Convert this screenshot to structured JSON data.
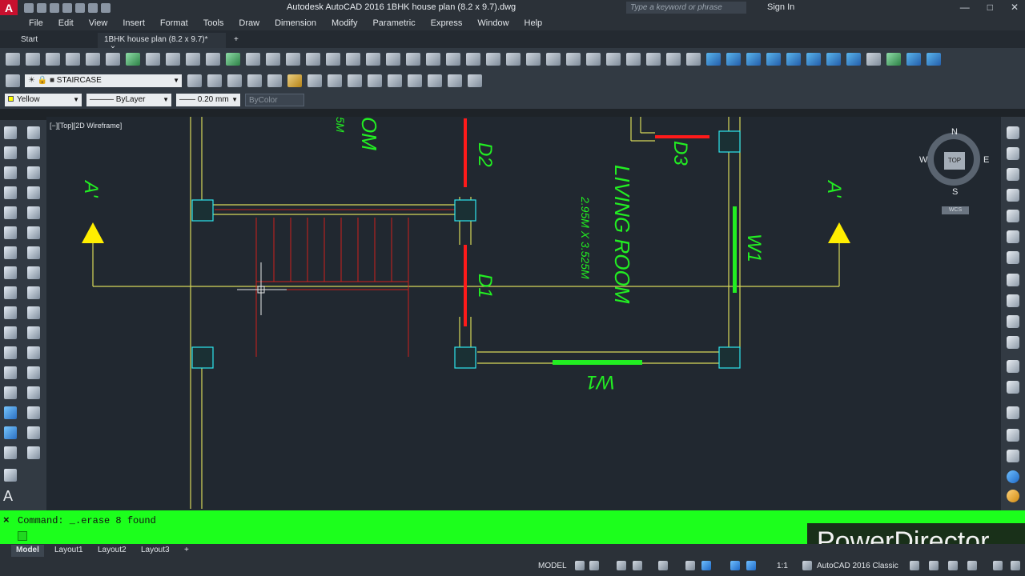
{
  "app": {
    "title": "Autodesk AutoCAD 2016    1BHK house plan (8.2 x 9.7).dwg",
    "search_placeholder": "Type a keyword or phrase",
    "sign_in": "Sign In",
    "logo": "A"
  },
  "menu": [
    "File",
    "Edit",
    "View",
    "Insert",
    "Format",
    "Tools",
    "Draw",
    "Dimension",
    "Modify",
    "Parametric",
    "Express",
    "Window",
    "Help"
  ],
  "doc_tabs": {
    "start": "Start",
    "active": "1BHK house plan (8.2 x 9.7)*",
    "close": "×",
    "add": "+"
  },
  "layer_toolbar": {
    "current_layer": "STAIRCASE"
  },
  "properties_toolbar": {
    "color": "Yellow",
    "linetype": "ByLayer",
    "lineweight": "0.20 mm",
    "plotstyle": "ByColor"
  },
  "viewport": {
    "label": "[−][Top][2D Wireframe]"
  },
  "viewcube": {
    "n": "N",
    "s": "S",
    "e": "E",
    "w": "W",
    "top": "TOP",
    "wcs": "WCS"
  },
  "drawing": {
    "room_name": "LIVING ROOM",
    "room_size": "2.95M X 3.525M",
    "partial_room": "OM",
    "partial_size": "5M",
    "door_d1": "D1",
    "door_d2": "D2",
    "door_d3": "D3",
    "window_w1_right": "W1",
    "window_w1_bottom": "W1",
    "section_left": "A'",
    "section_right": "A'",
    "colors": {
      "background": "#212830",
      "text_green": "#22ee22",
      "wall_yellow": "#d8d85a",
      "door_red": "#ff1a1a",
      "stair_red": "#d0201c",
      "column_cyan": "#2ee6ee",
      "arrow_yellow": "#ffee00"
    }
  },
  "command": {
    "text": "Command: _.erase 8 found",
    "close": "×"
  },
  "layout_tabs": [
    "Model",
    "Layout1",
    "Layout2",
    "Layout3"
  ],
  "layout_add": "+",
  "status": {
    "model": "MODEL",
    "scale": "1:1",
    "workspace": "AutoCAD 2016 Classic"
  },
  "watermark": "PowerDirector"
}
